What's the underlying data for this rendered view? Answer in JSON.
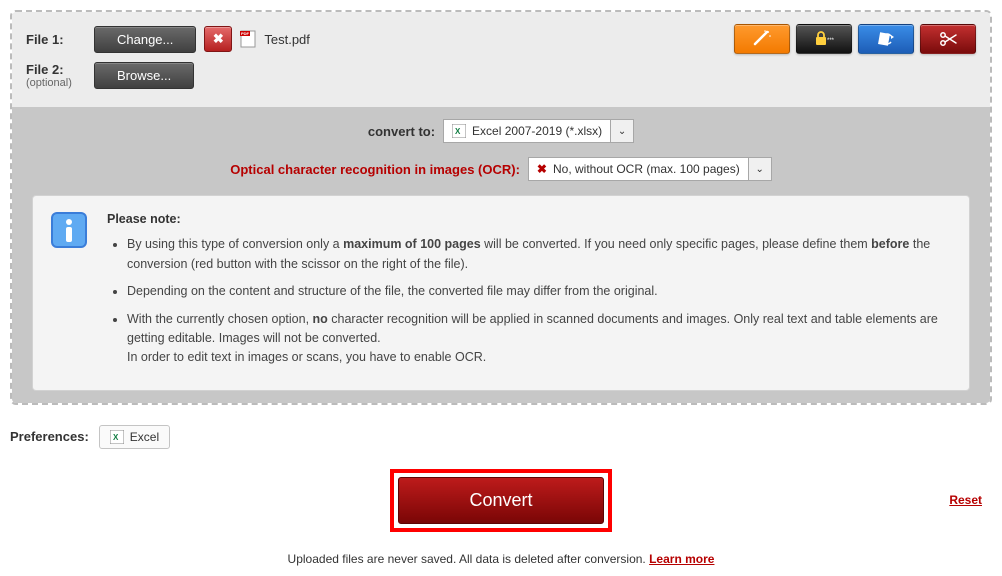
{
  "files": {
    "row1": {
      "label": "File 1:",
      "change_btn": "Change...",
      "filename": "Test.pdf"
    },
    "row2": {
      "label": "File 2:",
      "sublabel": "(optional)",
      "browse_btn": "Browse..."
    }
  },
  "toolbar_icons": {
    "wand": "magic-wand-icon",
    "lock": "lock-icon",
    "rotate": "rotate-icon",
    "scissors": "scissors-icon"
  },
  "options": {
    "convert_to_label": "convert to:",
    "convert_to_value": "Excel 2007-2019 (*.xlsx)",
    "ocr_label": "Optical character recognition in images (OCR):",
    "ocr_value": "No, without OCR (max. 100 pages)"
  },
  "note": {
    "title": "Please note:",
    "items": [
      "By using this type of conversion only a <b>maximum of 100 pages</b> will be converted. If you need only specific pages, please define them <b>before</b> the conversion (red button with the scissor on the right of the file).",
      "Depending on the content and structure of the file, the converted file may differ from the original.",
      "With the currently chosen option, <b>no</b> character recognition will be applied in scanned documents and images. Only real text and table elements are getting editable. Images will not be converted.<br>In order to edit text in images or scans, you have to enable OCR."
    ]
  },
  "prefs": {
    "label": "Preferences:",
    "chip": "Excel"
  },
  "convert_btn": "Convert",
  "reset": "Reset",
  "footer": {
    "text": "Uploaded files are never saved. All data is deleted after conversion. ",
    "link": "Learn more"
  }
}
